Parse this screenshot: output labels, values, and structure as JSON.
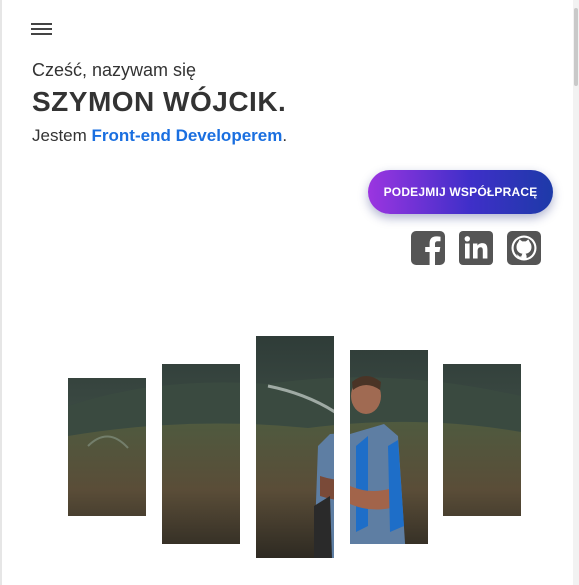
{
  "header": {
    "menu_icon": "hamburger-menu-icon"
  },
  "hero": {
    "greeting": "Cześć, nazywam się",
    "name": "SZYMON WÓJCIK.",
    "role_prefix": "Jestem ",
    "role_highlight": "Front-end Developerem",
    "role_suffix": ".",
    "accent_color": "#1a6fe0"
  },
  "cta": {
    "label": "PODEJMIJ WSPÓŁPRACĘ"
  },
  "social": [
    {
      "name": "Facebook",
      "icon": "facebook-icon"
    },
    {
      "name": "LinkedIn",
      "icon": "linkedin-icon"
    },
    {
      "name": "GitHub",
      "icon": "github-icon"
    }
  ],
  "photo": {
    "alt": "Szymon Wójcik w górach"
  }
}
